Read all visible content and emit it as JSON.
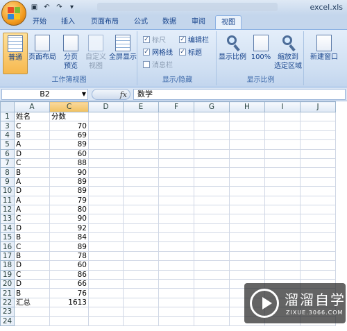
{
  "window": {
    "title": "excel.xls"
  },
  "tabs": [
    "开始",
    "插入",
    "页面布局",
    "公式",
    "数据",
    "审阅",
    "视图"
  ],
  "active_tab": "视图",
  "ribbon": {
    "group_workbook_views": {
      "label": "工作簿视图",
      "normal": "普通",
      "page_layout": "页面布局",
      "page_break": [
        "分页",
        "预览"
      ],
      "custom_views": [
        "自定义",
        "视图"
      ],
      "full_screen": "全屏显示"
    },
    "group_show_hide": {
      "label": "显示/隐藏",
      "ruler": "标尺",
      "formula_bar": "编辑栏",
      "gridlines": "网格线",
      "headings": "标题",
      "message_bar": "消息栏"
    },
    "group_zoom": {
      "label": "显示比例",
      "zoom": "显示比例",
      "zoom100": "100%",
      "zoom_selection": [
        "缩放到",
        "选定区域"
      ]
    },
    "new_window": "新建窗口"
  },
  "formula_bar": {
    "name_box": "B2",
    "fx": "fx",
    "content": "数学"
  },
  "sheet": {
    "columns": [
      "A",
      "C",
      "D",
      "E",
      "F",
      "G",
      "H",
      "I",
      "J"
    ],
    "selected_column": "C",
    "rows": [
      {
        "n": "1",
        "a": "姓名",
        "c": "分数"
      },
      {
        "n": "3",
        "a": "C",
        "c": "70"
      },
      {
        "n": "4",
        "a": "B",
        "c": "69"
      },
      {
        "n": "5",
        "a": "A",
        "c": "89"
      },
      {
        "n": "6",
        "a": "D",
        "c": "60"
      },
      {
        "n": "7",
        "a": "C",
        "c": "88"
      },
      {
        "n": "8",
        "a": "B",
        "c": "90"
      },
      {
        "n": "9",
        "a": "A",
        "c": "89"
      },
      {
        "n": "10",
        "a": "D",
        "c": "89"
      },
      {
        "n": "11",
        "a": "A",
        "c": "79"
      },
      {
        "n": "12",
        "a": "A",
        "c": "80"
      },
      {
        "n": "13",
        "a": "C",
        "c": "90"
      },
      {
        "n": "14",
        "a": "D",
        "c": "92"
      },
      {
        "n": "15",
        "a": "B",
        "c": "84"
      },
      {
        "n": "16",
        "a": "C",
        "c": "89"
      },
      {
        "n": "17",
        "a": "B",
        "c": "78"
      },
      {
        "n": "18",
        "a": "D",
        "c": "60"
      },
      {
        "n": "19",
        "a": "C",
        "c": "86"
      },
      {
        "n": "20",
        "a": "D",
        "c": "66"
      },
      {
        "n": "21",
        "a": "B",
        "c": "76"
      },
      {
        "n": "22",
        "a": "汇总",
        "c": "1613"
      },
      {
        "n": "23",
        "a": "",
        "c": ""
      },
      {
        "n": "24",
        "a": "",
        "c": ""
      }
    ]
  },
  "watermark": {
    "title": "溜溜自学",
    "url": "ZIXUE.3066.COM"
  }
}
